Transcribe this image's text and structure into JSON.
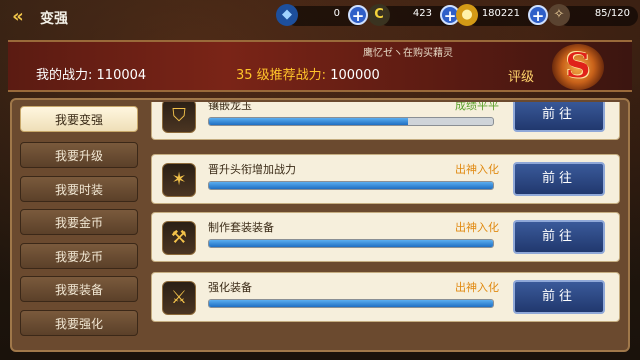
{
  "header": {
    "back_icon": "back-arrow-icon",
    "title": "变强",
    "resources": [
      {
        "name": "diamond",
        "icon": "diamond-icon",
        "value": "0",
        "color": "#3b8bff"
      },
      {
        "name": "dragon-coin",
        "icon": "dragon-coin-icon",
        "value": "423",
        "color": "#f3d23a"
      },
      {
        "name": "gold",
        "icon": "gold-coin-icon",
        "value": "180221",
        "color": "#f0c030"
      },
      {
        "name": "stamina",
        "icon": "stamina-wing-icon",
        "value": "85/120",
        "color": "#f3d6a0"
      }
    ]
  },
  "banner": {
    "power_label": "我的战力:",
    "power_value": "110004",
    "recommend_label": "35 级推荐战力:",
    "recommend_value": "100000",
    "ticker": "鹰忆ゼヽ在购买藉灵",
    "grade_label": "评级",
    "grade": "S"
  },
  "sidebar": {
    "items": [
      {
        "label": "我要变强",
        "active": true
      },
      {
        "label": "我要升级",
        "active": false
      },
      {
        "label": "我要时装",
        "active": false
      },
      {
        "label": "我要金币",
        "active": false
      },
      {
        "label": "我要龙币",
        "active": false
      },
      {
        "label": "我要装备",
        "active": false
      },
      {
        "label": "我要强化",
        "active": false
      }
    ]
  },
  "tasks": [
    {
      "name": "镶嵌龙玉",
      "status": "成绩平平",
      "status_color": "#5aa02a",
      "progress": 0.7,
      "button": "前往",
      "icon": "shield-gem-icon"
    },
    {
      "name": "晋升头衔增加战力",
      "status": "出神入化",
      "status_color": "#e08a12",
      "progress": 1.0,
      "button": "前往",
      "icon": "winged-emblem-icon"
    },
    {
      "name": "制作套装装备",
      "status": "出神入化",
      "status_color": "#e08a12",
      "progress": 1.0,
      "button": "前往",
      "icon": "anvil-icon"
    },
    {
      "name": "强化装备",
      "status": "出神入化",
      "status_color": "#e08a12",
      "progress": 1.0,
      "button": "前往",
      "icon": "sword-upgrade-icon"
    }
  ]
}
